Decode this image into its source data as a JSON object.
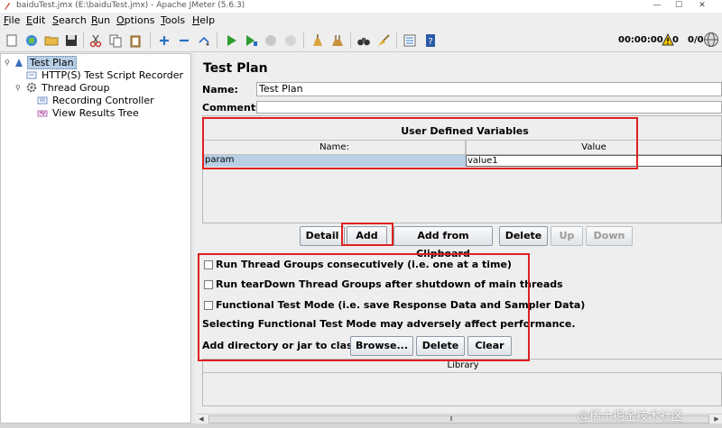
{
  "window": {
    "title": "baiduTest.jmx (E:\\baiduTest.jmx) - Apache JMeter (5.6.3)",
    "minimize": "—",
    "maximize": "☐",
    "close": "✕"
  },
  "menu": [
    "File",
    "Edit",
    "Search",
    "Run",
    "Options",
    "Tools",
    "Help"
  ],
  "toolbar": {
    "timer": "00:00:00",
    "warning_count": "0",
    "threads": "0/0"
  },
  "tree": {
    "items": [
      {
        "label": "Test Plan",
        "selected": true
      },
      {
        "label": "HTTP(S) Test Script Recorder"
      },
      {
        "label": "Thread Group"
      },
      {
        "label": "Recording Controller"
      },
      {
        "label": "View Results Tree"
      }
    ]
  },
  "test_plan": {
    "heading": "Test Plan",
    "name_label": "Name:",
    "name_value": "Test Plan",
    "comments_label": "Comments:",
    "comments_value": ""
  },
  "udv": {
    "title": "User Defined Variables",
    "columns": [
      "Name:",
      "Value"
    ],
    "rows": [
      {
        "name": "param",
        "value": "value1"
      }
    ]
  },
  "udv_buttons": [
    "Detail",
    "Add",
    "Add from Clipboard",
    "Delete",
    "Up",
    "Down"
  ],
  "options": {
    "run_consecutively": "Run Thread Groups consecutively (i.e. one at a time)",
    "run_teardown": "Run tearDown Thread Groups after shutdown of main threads",
    "functional_mode": "Functional Test Mode (i.e. save Response Data and Sampler Data)",
    "functional_note": "Selecting Functional Test Mode may adversely affect performance.",
    "classpath_label": "Add directory or jar to classpath",
    "browse": "Browse...",
    "delete": "Delete",
    "clear": "Clear",
    "library_header": "Library"
  },
  "watermark": "@稀土掘金技术社区",
  "colors": {
    "highlight": "#e02020",
    "selection": "#b8cfe5",
    "play": "#2e9e2e"
  }
}
